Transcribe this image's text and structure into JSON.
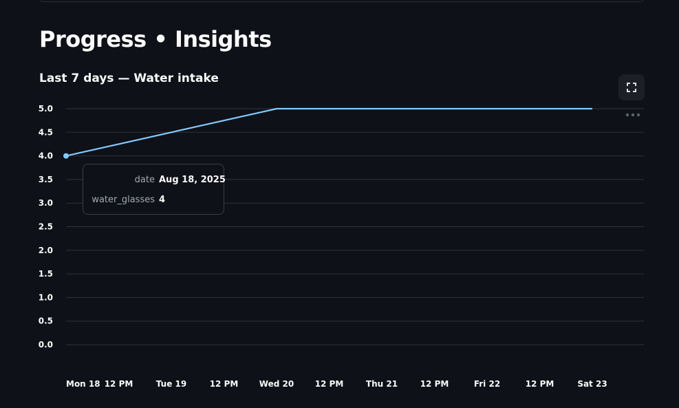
{
  "page": {
    "title": "Progress • Insights"
  },
  "toolbar": {
    "fullscreen_icon": "fullscreen-expand-icon",
    "more_icon": "more-horizontal-icon"
  },
  "tooltip": {
    "date_key": "date",
    "date_value": "Aug 18, 2025",
    "value_key": "water_glasses",
    "value_value": "4"
  },
  "colors": {
    "background": "#0e1117",
    "line": "#83c9ff",
    "grid": "#31333f",
    "text": "#fafafa"
  },
  "chart_data": {
    "type": "line",
    "title": "Last 7 days — Water intake",
    "xlabel": "",
    "ylabel": "",
    "x": [
      "2025-08-18",
      "2025-08-20",
      "2025-08-23"
    ],
    "series": [
      {
        "values": [
          4,
          5,
          5
        ]
      }
    ],
    "ylim": [
      0,
      5
    ],
    "yticks": [
      "0.0",
      "0.5",
      "1.0",
      "1.5",
      "2.0",
      "2.5",
      "3.0",
      "3.5",
      "4.0",
      "4.5",
      "5.0"
    ],
    "xticks": [
      "Mon 18",
      "12 PM",
      "Tue 19",
      "12 PM",
      "Wed 20",
      "12 PM",
      "Thu 21",
      "12 PM",
      "Fri 22",
      "12 PM",
      "Sat 23"
    ],
    "grid": true,
    "legend": "none"
  }
}
